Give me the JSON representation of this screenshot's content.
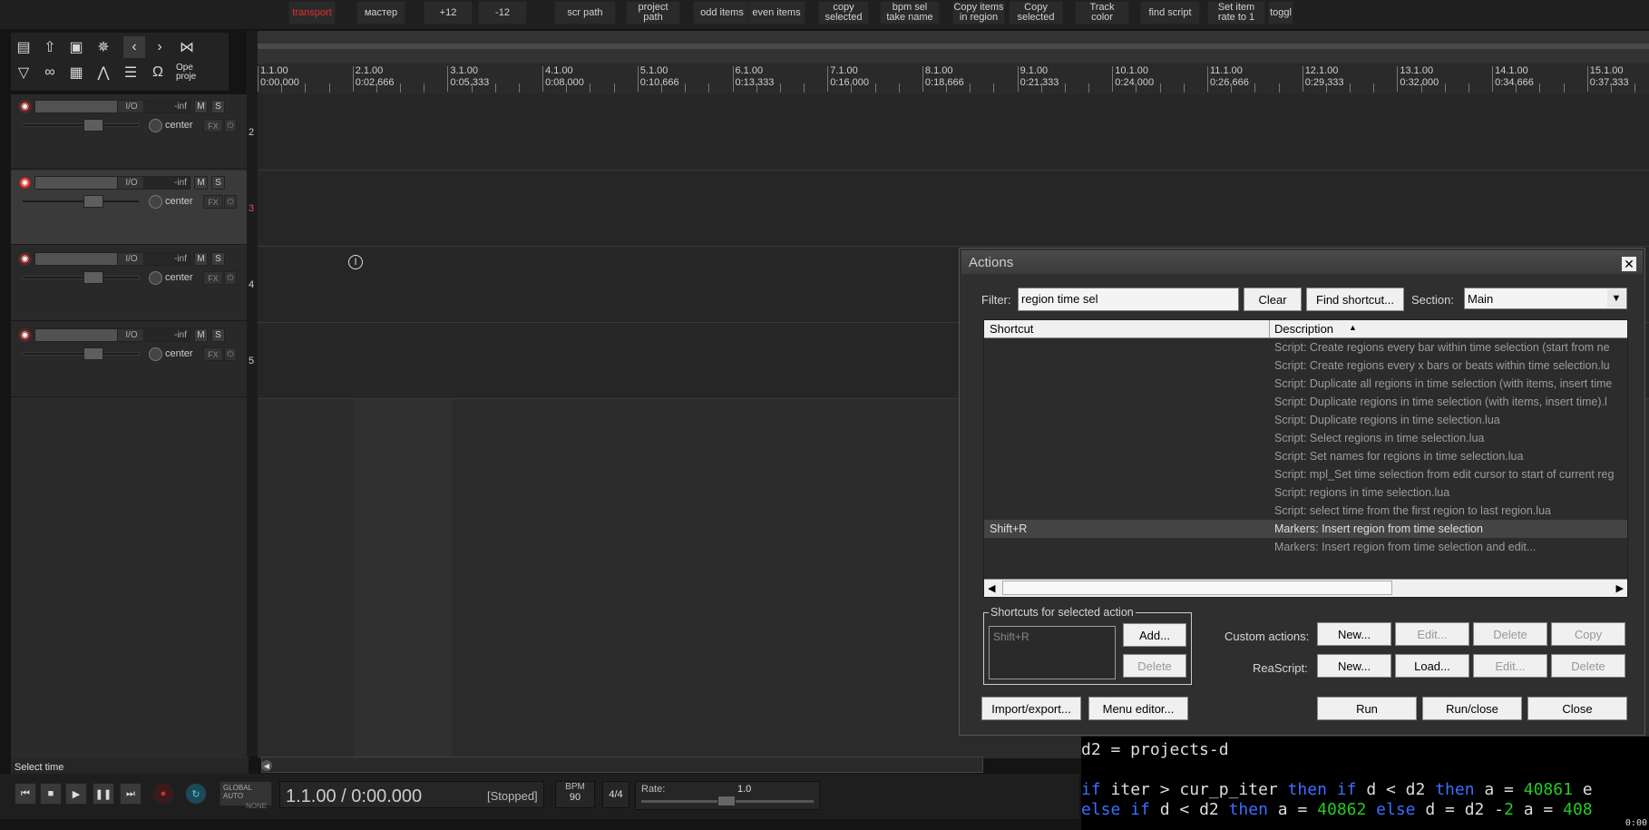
{
  "toolbar": {
    "buttons": [
      {
        "label": "transport",
        "color": "#e03030"
      },
      {
        "label": "мастер"
      },
      {
        "label": "+12"
      },
      {
        "label": "-12"
      },
      {
        "label": "scr path"
      },
      {
        "label": "project\npath"
      },
      {
        "label": "odd items"
      },
      {
        "label": "even items"
      },
      {
        "label": "copy\nselected"
      },
      {
        "label": "bpm sel\ntake name"
      },
      {
        "label": "Copy items\nin region"
      },
      {
        "label": "Copy\nselected"
      },
      {
        "label": "Track\ncolor"
      },
      {
        "label": "find script"
      },
      {
        "label": "Set item\nrate to 1"
      },
      {
        "label": "toggl"
      }
    ]
  },
  "left_toolbar": {
    "icons": [
      "new-project-icon",
      "open-project-icon",
      "save-project-icon",
      "attach-icon",
      "undo-icon",
      "redo-icon",
      "cut-tool-icon",
      "select-tool-icon",
      "link-icon",
      "grid-icon",
      "envelope-icon",
      "ripple-icon",
      "snap-magnet-icon"
    ],
    "open_project_label": "Ope\nproje"
  },
  "ruler": {
    "marks": [
      {
        "bar": "1.1.00",
        "time": "0:00.000"
      },
      {
        "bar": "2.1.00",
        "time": "0:02.666"
      },
      {
        "bar": "3.1.00",
        "time": "0:05.333"
      },
      {
        "bar": "4.1.00",
        "time": "0:08.000"
      },
      {
        "bar": "5.1.00",
        "time": "0:10.666"
      },
      {
        "bar": "6.1.00",
        "time": "0:13.333"
      },
      {
        "bar": "7.1.00",
        "time": "0:16.000"
      },
      {
        "bar": "8.1.00",
        "time": "0:18.666"
      },
      {
        "bar": "9.1.00",
        "time": "0:21.333"
      },
      {
        "bar": "10.1.00",
        "time": "0:24.000"
      },
      {
        "bar": "11.1.00",
        "time": "0:26.666"
      },
      {
        "bar": "12.1.00",
        "time": "0:29.333"
      },
      {
        "bar": "13.1.00",
        "time": "0:32.000"
      },
      {
        "bar": "14.1.00",
        "time": "0:34.666"
      },
      {
        "bar": "15.1.00",
        "time": "0:37.333"
      }
    ]
  },
  "tracks": [
    {
      "number": "2",
      "io": "I/O",
      "volume": "-inf",
      "mute": "M",
      "solo": "S",
      "pan": "center",
      "fx": "FX",
      "selected": false
    },
    {
      "number": "3",
      "io": "I/O",
      "volume": "-inf",
      "mute": "M",
      "solo": "S",
      "pan": "center",
      "fx": "FX",
      "selected": true
    },
    {
      "number": "4",
      "io": "I/O",
      "volume": "-inf",
      "mute": "M",
      "solo": "S",
      "pan": "center",
      "fx": "FX",
      "selected": false
    },
    {
      "number": "5",
      "io": "I/O",
      "volume": "-inf",
      "mute": "M",
      "solo": "S",
      "pan": "center",
      "fx": "FX",
      "selected": false
    }
  ],
  "status_text": "Select time",
  "transport": {
    "global_auto": "GLOBAL AUTO",
    "none": "NONE",
    "position": "1.1.00 / 0:00.000",
    "state": "[Stopped]",
    "bpm_label": "BPM",
    "bpm": "90",
    "time_sig": "4/4",
    "rate_label": "Rate:",
    "rate": "1.0"
  },
  "actions_dialog": {
    "title": "Actions",
    "filter_label": "Filter:",
    "filter_value": "region time sel",
    "clear": "Clear",
    "find_shortcut": "Find shortcut...",
    "section_label": "Section:",
    "section_value": "Main",
    "col_shortcut": "Shortcut",
    "col_description": "Description",
    "rows": [
      {
        "shortcut": "",
        "description": "Script: Create regions every bar within time selection (start from ne"
      },
      {
        "shortcut": "",
        "description": "Script: Create regions every x bars or beats within time selection.lu"
      },
      {
        "shortcut": "",
        "description": "Script: Duplicate all regions in time selection (with items, insert time"
      },
      {
        "shortcut": "",
        "description": "Script: Duplicate regions in time selection (with items, insert time).l"
      },
      {
        "shortcut": "",
        "description": "Script: Duplicate regions in time selection.lua"
      },
      {
        "shortcut": "",
        "description": "Script: Select regions in time selection.lua"
      },
      {
        "shortcut": "",
        "description": "Script: Set names for regions in time selection.lua"
      },
      {
        "shortcut": "",
        "description": "Script: mpl_Set time selection from edit cursor to start of current reg"
      },
      {
        "shortcut": "",
        "description": "Script: regions in time selection.lua"
      },
      {
        "shortcut": "",
        "description": "Script: select time from the first region to last region.lua"
      },
      {
        "shortcut": "Shift+R",
        "description": "Markers: Insert region from time selection",
        "highlighted": true
      },
      {
        "shortcut": "",
        "description": "Markers: Insert region from time selection and edit..."
      }
    ],
    "shortcuts_group_label": "Shortcuts for selected action",
    "shortcut_entry": "Shift+R",
    "add": "Add...",
    "delete": "Delete",
    "custom_actions_label": "Custom actions:",
    "reascript_label": "ReaScript:",
    "new": "New...",
    "edit": "Edit...",
    "copy": "Copy",
    "load": "Load...",
    "import_export": "Import/export...",
    "menu_editor": "Menu editor...",
    "run": "Run",
    "run_close": "Run/close",
    "close": "Close"
  },
  "code_panel": {
    "line1": "d2 = projects-d",
    "line2_parts": [
      "if",
      " iter > cur_p_iter ",
      "then",
      " ",
      "if",
      " d < d2 ",
      "then",
      " a = ",
      "40861",
      " e"
    ],
    "line3_parts": [
      "else",
      " ",
      "if",
      " d < d2 ",
      "then",
      " a = ",
      "40862",
      " ",
      "else",
      " d = d2 -",
      "2",
      " a = ",
      "408"
    ],
    "corner": "0:00"
  }
}
